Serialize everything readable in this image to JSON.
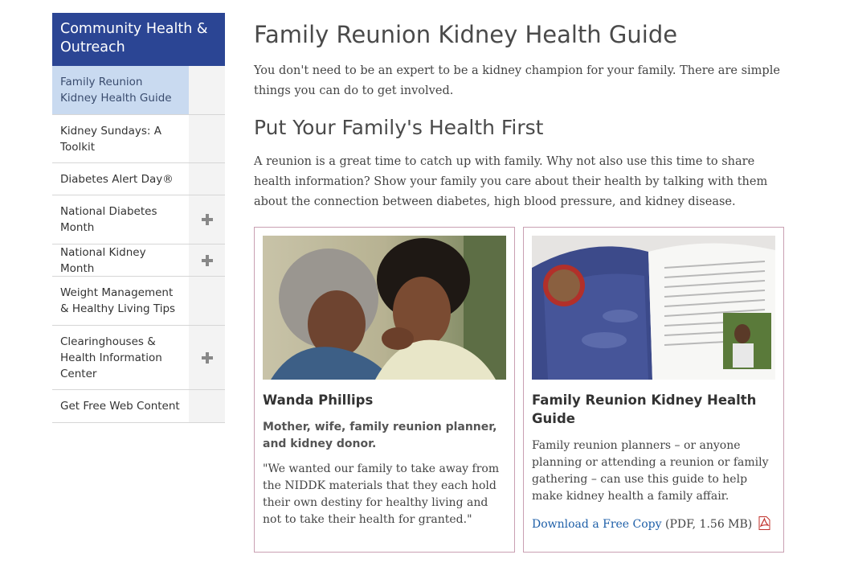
{
  "sidebar": {
    "title": "Community Health & Outreach",
    "items": [
      {
        "label": "Family Reunion Kidney Health Guide",
        "active": true,
        "expandable": false
      },
      {
        "label": "Kidney Sundays: A Toolkit",
        "active": false,
        "expandable": false
      },
      {
        "label": "Diabetes Alert Day®",
        "active": false,
        "expandable": false
      },
      {
        "label": "National Diabetes Month",
        "active": false,
        "expandable": true
      },
      {
        "label": "National Kidney Month",
        "active": false,
        "expandable": true
      },
      {
        "label": "Weight Management & Healthy Living Tips",
        "active": false,
        "expandable": false
      },
      {
        "label": "Clearinghouses & Health Information Center",
        "active": false,
        "expandable": true
      },
      {
        "label": "Get Free Web Content",
        "active": false,
        "expandable": false
      }
    ]
  },
  "main": {
    "title": "Family Reunion Kidney Health Guide",
    "intro": "You don't need to be an expert to be a kidney champion for your family. There are simple things you can do to get involved.",
    "subheading": "Put Your Family's Health First",
    "paragraph": "A reunion is a great time to catch up with family. Why not also use this time to share health information? Show your family you care about their health by talking with them about the connection between diabetes, high blood pressure, and kidney disease."
  },
  "cards": {
    "testimonial": {
      "name": "Wanda Phillips",
      "subtitle": "Mother, wife, family reunion planner, and kidney donor.",
      "quote": "\"We wanted our family to take away from the NIDDK materials that they each hold their own destiny for healthy living and not to take their health for granted.\""
    },
    "guide": {
      "title": "Family Reunion Kidney Health Guide",
      "text": "Family reunion planners – or anyone planning or attending a reunion or family gathering – can use this guide to help make kidney health a family affair.",
      "download_link": "Download a Free Copy",
      "download_meta": "(PDF, 1.56 MB)"
    }
  },
  "colors": {
    "sidebar_header": "#2b4594",
    "active_item": "#c9daf0",
    "card_border": "#c9a0b2",
    "link": "#1e5fa8"
  },
  "icons": {
    "expand": "plus-icon",
    "pdf": "pdf-icon"
  }
}
